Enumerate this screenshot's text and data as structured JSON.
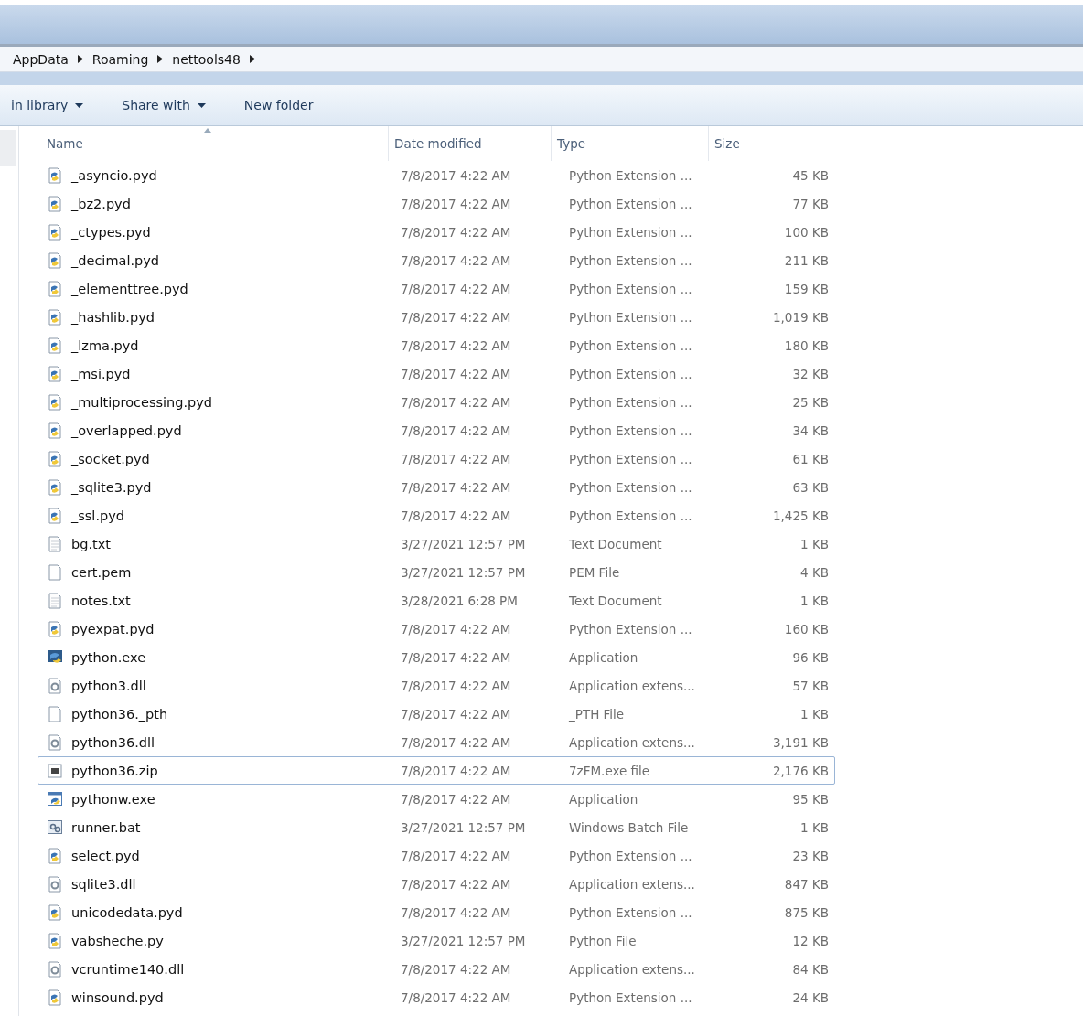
{
  "breadcrumb": [
    "AppData",
    "Roaming",
    "nettools48"
  ],
  "toolbar": [
    {
      "label": "in library",
      "dropdown": true
    },
    {
      "label": "Share with",
      "dropdown": true
    },
    {
      "label": "New folder",
      "dropdown": false
    }
  ],
  "columns": [
    "Name",
    "Date modified",
    "Type",
    "Size"
  ],
  "files": [
    {
      "name": "_asyncio.pyd",
      "date": "7/8/2017 4:22 AM",
      "type": "Python Extension ...",
      "size": "45 KB",
      "kind": "pyd",
      "selected": false
    },
    {
      "name": "_bz2.pyd",
      "date": "7/8/2017 4:22 AM",
      "type": "Python Extension ...",
      "size": "77 KB",
      "kind": "pyd",
      "selected": false
    },
    {
      "name": "_ctypes.pyd",
      "date": "7/8/2017 4:22 AM",
      "type": "Python Extension ...",
      "size": "100 KB",
      "kind": "pyd",
      "selected": false
    },
    {
      "name": "_decimal.pyd",
      "date": "7/8/2017 4:22 AM",
      "type": "Python Extension ...",
      "size": "211 KB",
      "kind": "pyd",
      "selected": false
    },
    {
      "name": "_elementtree.pyd",
      "date": "7/8/2017 4:22 AM",
      "type": "Python Extension ...",
      "size": "159 KB",
      "kind": "pyd",
      "selected": false
    },
    {
      "name": "_hashlib.pyd",
      "date": "7/8/2017 4:22 AM",
      "type": "Python Extension ...",
      "size": "1,019 KB",
      "kind": "pyd",
      "selected": false
    },
    {
      "name": "_lzma.pyd",
      "date": "7/8/2017 4:22 AM",
      "type": "Python Extension ...",
      "size": "180 KB",
      "kind": "pyd",
      "selected": false
    },
    {
      "name": "_msi.pyd",
      "date": "7/8/2017 4:22 AM",
      "type": "Python Extension ...",
      "size": "32 KB",
      "kind": "pyd",
      "selected": false
    },
    {
      "name": "_multiprocessing.pyd",
      "date": "7/8/2017 4:22 AM",
      "type": "Python Extension ...",
      "size": "25 KB",
      "kind": "pyd",
      "selected": false
    },
    {
      "name": "_overlapped.pyd",
      "date": "7/8/2017 4:22 AM",
      "type": "Python Extension ...",
      "size": "34 KB",
      "kind": "pyd",
      "selected": false
    },
    {
      "name": "_socket.pyd",
      "date": "7/8/2017 4:22 AM",
      "type": "Python Extension ...",
      "size": "61 KB",
      "kind": "pyd",
      "selected": false
    },
    {
      "name": "_sqlite3.pyd",
      "date": "7/8/2017 4:22 AM",
      "type": "Python Extension ...",
      "size": "63 KB",
      "kind": "pyd",
      "selected": false
    },
    {
      "name": "_ssl.pyd",
      "date": "7/8/2017 4:22 AM",
      "type": "Python Extension ...",
      "size": "1,425 KB",
      "kind": "pyd",
      "selected": false
    },
    {
      "name": "bg.txt",
      "date": "3/27/2021 12:57 PM",
      "type": "Text Document",
      "size": "1 KB",
      "kind": "text",
      "selected": false
    },
    {
      "name": "cert.pem",
      "date": "3/27/2021 12:57 PM",
      "type": "PEM File",
      "size": "4 KB",
      "kind": "blank",
      "selected": false
    },
    {
      "name": "notes.txt",
      "date": "3/28/2021 6:28 PM",
      "type": "Text Document",
      "size": "1 KB",
      "kind": "text",
      "selected": false
    },
    {
      "name": "pyexpat.pyd",
      "date": "7/8/2017 4:22 AM",
      "type": "Python Extension ...",
      "size": "160 KB",
      "kind": "pyd",
      "selected": false
    },
    {
      "name": "python.exe",
      "date": "7/8/2017 4:22 AM",
      "type": "Application",
      "size": "96 KB",
      "kind": "exe",
      "selected": false
    },
    {
      "name": "python3.dll",
      "date": "7/8/2017 4:22 AM",
      "type": "Application extens...",
      "size": "57 KB",
      "kind": "dll",
      "selected": false
    },
    {
      "name": "python36._pth",
      "date": "7/8/2017 4:22 AM",
      "type": "_PTH File",
      "size": "1 KB",
      "kind": "blank",
      "selected": false
    },
    {
      "name": "python36.dll",
      "date": "7/8/2017 4:22 AM",
      "type": "Application extens...",
      "size": "3,191 KB",
      "kind": "dll",
      "selected": false
    },
    {
      "name": "python36.zip",
      "date": "7/8/2017 4:22 AM",
      "type": "7zFM.exe file",
      "size": "2,176 KB",
      "kind": "zip",
      "selected": true
    },
    {
      "name": "pythonw.exe",
      "date": "7/8/2017 4:22 AM",
      "type": "Application",
      "size": "95 KB",
      "kind": "window",
      "selected": false
    },
    {
      "name": "runner.bat",
      "date": "3/27/2021 12:57 PM",
      "type": "Windows Batch File",
      "size": "1 KB",
      "kind": "bat",
      "selected": false
    },
    {
      "name": "select.pyd",
      "date": "7/8/2017 4:22 AM",
      "type": "Python Extension ...",
      "size": "23 KB",
      "kind": "pyd",
      "selected": false
    },
    {
      "name": "sqlite3.dll",
      "date": "7/8/2017 4:22 AM",
      "type": "Application extens...",
      "size": "847 KB",
      "kind": "dll",
      "selected": false
    },
    {
      "name": "unicodedata.pyd",
      "date": "7/8/2017 4:22 AM",
      "type": "Python Extension ...",
      "size": "875 KB",
      "kind": "pyd",
      "selected": false
    },
    {
      "name": "vabsheche.py",
      "date": "3/27/2021 12:57 PM",
      "type": "Python File",
      "size": "12 KB",
      "kind": "pyd",
      "selected": false
    },
    {
      "name": "vcruntime140.dll",
      "date": "7/8/2017 4:22 AM",
      "type": "Application extens...",
      "size": "84 KB",
      "kind": "dll",
      "selected": false
    },
    {
      "name": "winsound.pyd",
      "date": "7/8/2017 4:22 AM",
      "type": "Python Extension ...",
      "size": "24 KB",
      "kind": "pyd",
      "selected": false
    }
  ]
}
